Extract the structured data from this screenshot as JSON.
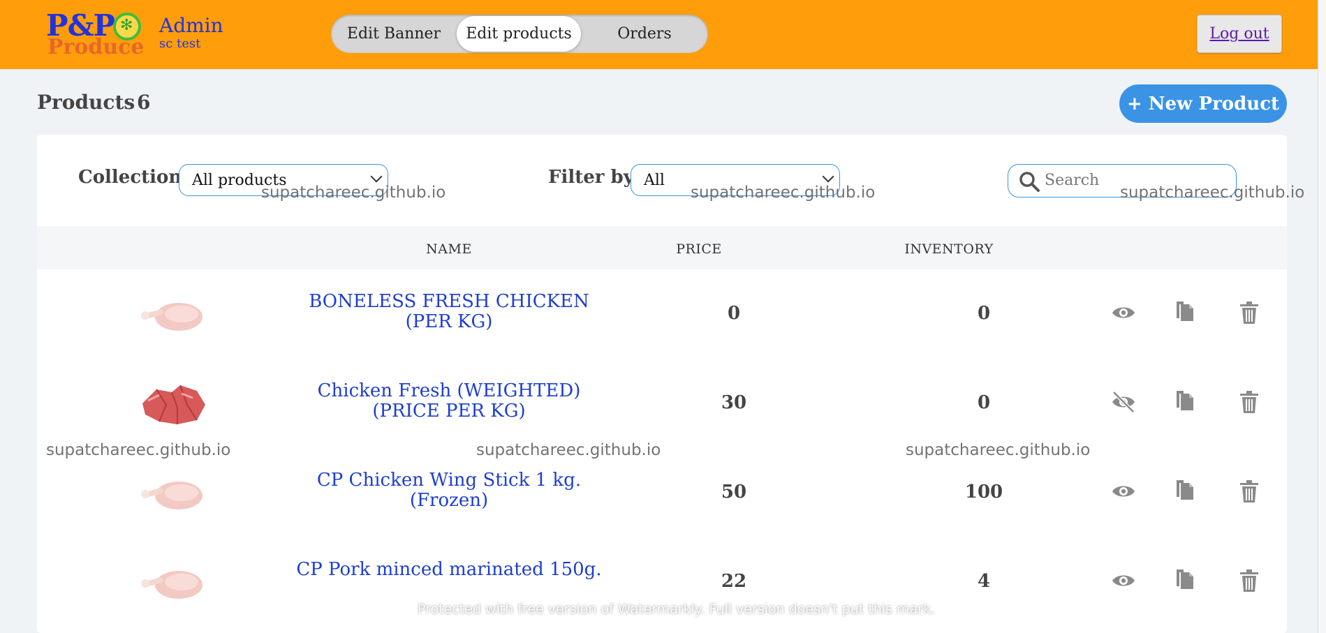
{
  "header": {
    "logo": "P&P Produce",
    "title": "Admin",
    "subtitle": "sc test",
    "tabs": [
      {
        "label": "Edit Banner"
      },
      {
        "label": "Edit products"
      },
      {
        "label": "Orders"
      }
    ],
    "active_tab": "Edit products",
    "logout_label": "Log out"
  },
  "page": {
    "title": "Products",
    "count": "6",
    "new_button": "+ New Product"
  },
  "filters": {
    "collection_label": "Collection",
    "collection_value": "All products",
    "filter_label": "Filter by",
    "filter_value": "All",
    "search_placeholder": "Search"
  },
  "table": {
    "columns": [
      "NAME",
      "PRICE",
      "INVENTORY"
    ],
    "rows": [
      {
        "name": "BONELESS FRESH CHICKEN (PER KG)",
        "price": "0",
        "inventory": "0",
        "visible": true,
        "image": "chicken-leg"
      },
      {
        "name": "Chicken Fresh (WEIGHTED) (PRICE PER KG)",
        "price": "30",
        "inventory": "0",
        "visible": false,
        "image": "raw-meat"
      },
      {
        "name": "CP Chicken Wing Stick 1 kg. (Frozen)",
        "price": "50",
        "inventory": "100",
        "visible": true,
        "image": "chicken-leg"
      },
      {
        "name": "CP Pork minced marinated 150g.",
        "price": "22",
        "inventory": "4",
        "visible": true,
        "image": "chicken-leg"
      }
    ]
  },
  "watermarks": {
    "site": "supatchareec.github.io",
    "footer": "Protected with free version of Watermarkly. Full version doesn't put this mark."
  },
  "colors": {
    "header_bg": "#ff9d0a",
    "accent": "#3b93e6",
    "link": "#1e3ed0",
    "logout_text": "#5a1aa8"
  }
}
